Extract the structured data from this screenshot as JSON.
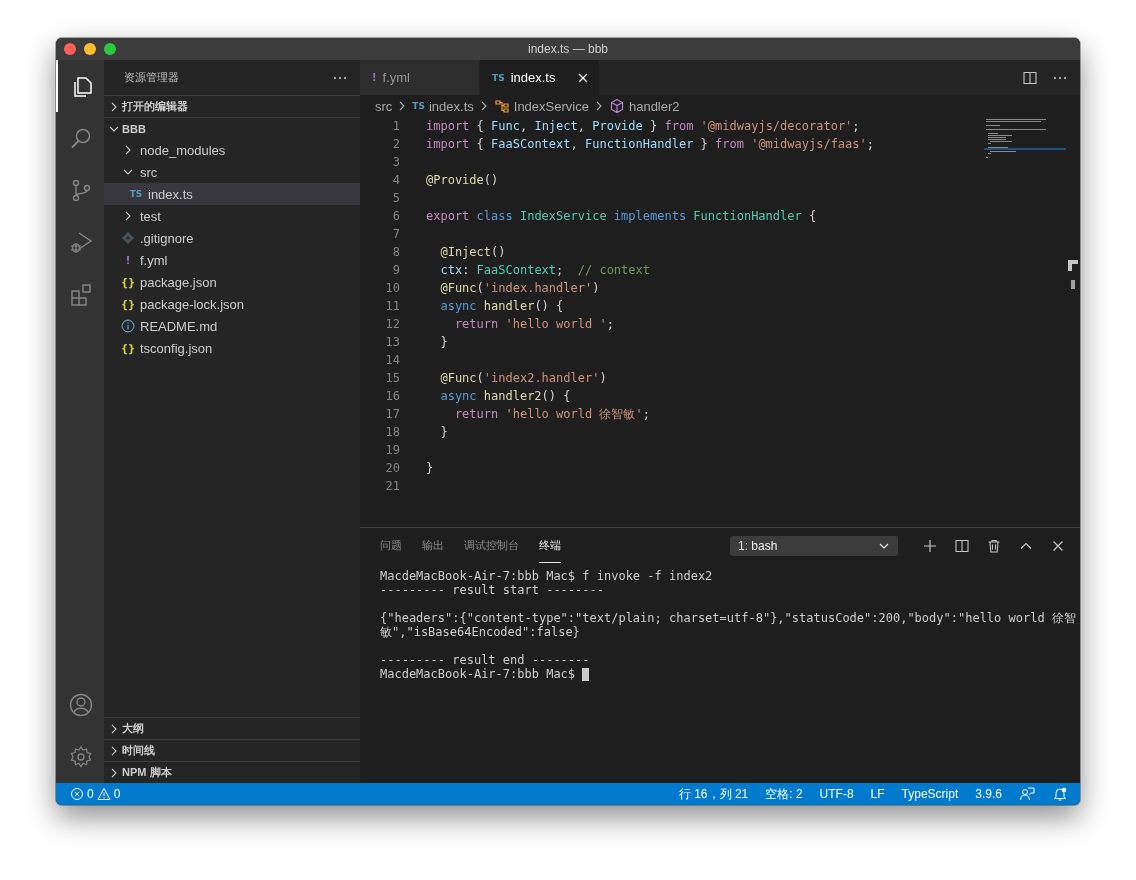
{
  "window": {
    "title": "index.ts — bbb"
  },
  "activity_bar": {
    "top": [
      {
        "kind": "files",
        "selected": true
      },
      {
        "kind": "search",
        "selected": false
      },
      {
        "kind": "source-control",
        "selected": false
      },
      {
        "kind": "run",
        "selected": false
      },
      {
        "kind": "extensions",
        "selected": false
      }
    ],
    "bottom": [
      {
        "kind": "account",
        "selected": false
      },
      {
        "kind": "settings",
        "selected": false
      }
    ]
  },
  "sidebar": {
    "title": "资源管理器",
    "sections": [
      {
        "label": "打开的编辑器",
        "expanded": false
      },
      {
        "label": "BBB",
        "expanded": true,
        "items": [
          {
            "label": "node_modules",
            "kind": "folder",
            "expanded": false,
            "selected": false
          },
          {
            "label": "src",
            "kind": "folder",
            "expanded": true,
            "selected": false,
            "children": [
              {
                "label": "index.ts",
                "kind": "ts",
                "icon": "TS",
                "selected": true
              }
            ]
          },
          {
            "label": "test",
            "kind": "folder",
            "expanded": false,
            "selected": false
          },
          {
            "label": ".gitignore",
            "kind": "git",
            "selected": false
          },
          {
            "label": "f.yml",
            "kind": "yml",
            "icon": "!",
            "selected": false
          },
          {
            "label": "package.json",
            "kind": "json",
            "icon": "{}",
            "selected": false
          },
          {
            "label": "package-lock.json",
            "kind": "json",
            "icon": "{}",
            "selected": false
          },
          {
            "label": "README.md",
            "kind": "info",
            "selected": false
          },
          {
            "label": "tsconfig.json",
            "kind": "json",
            "icon": "{}",
            "selected": false
          }
        ]
      },
      {
        "label": "大纲",
        "expanded": false
      },
      {
        "label": "时间线",
        "expanded": false
      },
      {
        "label": "NPM 脚本",
        "expanded": false
      }
    ]
  },
  "editor": {
    "tabs": [
      {
        "label": "f.yml",
        "kind": "yml",
        "icon": "!",
        "selected": false
      },
      {
        "label": "index.ts",
        "kind": "ts",
        "icon": "TS",
        "selected": true
      }
    ],
    "breadcrumbs": [
      {
        "label": "src",
        "kind": "folder"
      },
      {
        "label": "index.ts",
        "kind": "ts",
        "icon": "TS"
      },
      {
        "label": "IndexService",
        "kind": "class"
      },
      {
        "label": "handler2",
        "kind": "method"
      }
    ],
    "lines": [
      {
        "number": "1",
        "tokens": [
          {
            "t": "import",
            "color": "#c586c0"
          },
          {
            "t": " { "
          },
          {
            "t": "Func",
            "color": "#9cdcfe"
          },
          {
            "t": ", "
          },
          {
            "t": "Inject",
            "color": "#9cdcfe"
          },
          {
            "t": ", "
          },
          {
            "t": "Provide",
            "color": "#9cdcfe"
          },
          {
            "t": " } "
          },
          {
            "t": "from ",
            "color": "#c586c0"
          },
          {
            "t": "'@midwayjs/decorator'",
            "color": "#ce9178"
          },
          {
            "t": ";"
          }
        ]
      },
      {
        "number": "2",
        "tokens": [
          {
            "t": "import",
            "color": "#c586c0"
          },
          {
            "t": " { "
          },
          {
            "t": "FaaSContext",
            "color": "#9cdcfe"
          },
          {
            "t": ", "
          },
          {
            "t": "FunctionHandler",
            "color": "#9cdcfe"
          },
          {
            "t": " } "
          },
          {
            "t": "from ",
            "color": "#c586c0"
          },
          {
            "t": "'@midwayjs/faas'",
            "color": "#ce9178"
          },
          {
            "t": ";"
          }
        ]
      },
      {
        "number": "3"
      },
      {
        "number": "4",
        "tokens": [
          {
            "t": "@Provide",
            "color": "#dcdcaa"
          },
          {
            "t": "()"
          }
        ]
      },
      {
        "number": "5"
      },
      {
        "number": "6",
        "tokens": [
          {
            "t": "export ",
            "color": "#c586c0"
          },
          {
            "t": "class ",
            "color": "#569cd6"
          },
          {
            "t": "IndexService ",
            "color": "#4ec9b0"
          },
          {
            "t": "implements ",
            "color": "#569cd6"
          },
          {
            "t": "FunctionHandler",
            "color": "#4ec9b0"
          },
          {
            "t": " {"
          }
        ]
      },
      {
        "number": "7"
      },
      {
        "number": "8",
        "tokens": [
          {
            "t": "  @Inject",
            "color": "#dcdcaa"
          },
          {
            "t": "()"
          }
        ]
      },
      {
        "number": "9",
        "tokens": [
          {
            "t": "  ctx",
            "color": "#9cdcfe"
          },
          {
            "t": ": "
          },
          {
            "t": "FaaSContext",
            "color": "#4ec9b0"
          },
          {
            "t": ";  "
          },
          {
            "t": "// context",
            "color": "#6a9955"
          }
        ]
      },
      {
        "number": "10",
        "tokens": [
          {
            "t": "  @Func",
            "color": "#dcdcaa"
          },
          {
            "t": "("
          },
          {
            "t": "'index.handler'",
            "color": "#ce9178"
          },
          {
            "t": ")"
          }
        ]
      },
      {
        "number": "11",
        "tokens": [
          {
            "t": "  async ",
            "color": "#569cd6"
          },
          {
            "t": "handler",
            "color": "#dcdcaa"
          },
          {
            "t": "() {"
          }
        ]
      },
      {
        "number": "12",
        "tokens": [
          {
            "t": "    return ",
            "color": "#c586c0"
          },
          {
            "t": "'hello world '",
            "color": "#ce9178"
          },
          {
            "t": ";"
          }
        ]
      },
      {
        "number": "13",
        "tokens": [
          {
            "t": "  }"
          }
        ]
      },
      {
        "number": "14"
      },
      {
        "number": "15",
        "tokens": [
          {
            "t": "  @Func",
            "color": "#dcdcaa"
          },
          {
            "t": "("
          },
          {
            "t": "'index2.handler'",
            "color": "#ce9178"
          },
          {
            "t": ")"
          }
        ]
      },
      {
        "number": "16",
        "tokens": [
          {
            "t": "  async ",
            "color": "#569cd6"
          },
          {
            "t": "handler2",
            "color": "#dcdcaa"
          },
          {
            "t": "() {"
          }
        ]
      },
      {
        "number": "17",
        "tokens": [
          {
            "t": "    return ",
            "color": "#c586c0"
          },
          {
            "t": "'hello world 徐智敏'",
            "color": "#ce9178"
          },
          {
            "t": ";"
          }
        ]
      },
      {
        "number": "18",
        "tokens": [
          {
            "t": "  }"
          }
        ]
      },
      {
        "number": "19"
      },
      {
        "number": "20",
        "tokens": [
          {
            "t": "}"
          }
        ]
      },
      {
        "number": "21"
      }
    ]
  },
  "panel": {
    "tabs": [
      {
        "label": "问题",
        "selected": false
      },
      {
        "label": "输出",
        "selected": false
      },
      {
        "label": "调试控制台",
        "selected": false
      },
      {
        "label": "终端",
        "selected": true
      }
    ],
    "terminal_select": "1: bash",
    "terminal": [
      [
        "MacdeMacBook-Air-7:bbb Mac$ f invoke -f index2",
        "--------- result start --------"
      ],
      [
        "{\"headers\":{\"content-type\":\"text/plain; charset=utf-8\"},\"statusCode\":200,\"body\":\"hello world 徐智",
        "敏\",\"isBase64Encoded\":false}"
      ],
      [
        "--------- result end --------",
        "MacdeMacBook-Air-7:bbb Mac$ "
      ]
    ]
  },
  "status_bar": {
    "errors": "0",
    "warnings": "0",
    "items": [
      "行 16，列 21",
      "空格: 2",
      "UTF-8",
      "LF",
      "TypeScript",
      "3.9.6"
    ]
  }
}
